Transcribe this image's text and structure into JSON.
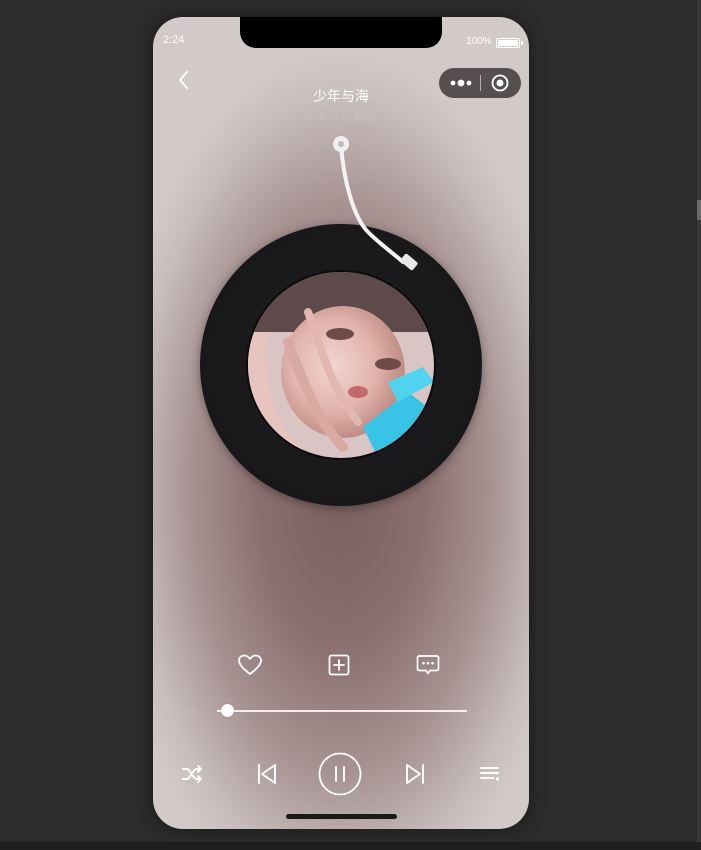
{
  "status_bar": {
    "time": "2:24",
    "battery": "100%"
  },
  "song": {
    "title": "少年与海",
    "artist": "G.E.M.邓紫棋"
  },
  "playback": {
    "current": "00:09",
    "total": "03:43",
    "progress_fraction": 0.04,
    "state": "playing"
  },
  "icons": {
    "back": "chevron-left-icon",
    "capsule_more": "more-dots-icon",
    "capsule_close": "target-circle-icon",
    "like": "heart-outline-icon",
    "add": "plus-square-icon",
    "comment": "comment-bubble-icon",
    "shuffle": "shuffle-icon",
    "previous": "skip-previous-icon",
    "pause": "pause-circle-icon",
    "next": "skip-next-icon",
    "playlist": "playlist-icon"
  },
  "colors": {
    "page_bg": "#2c2c2c",
    "player_center": "#7a5f5e",
    "player_edge": "#d2cac9",
    "disc": "#141415"
  }
}
